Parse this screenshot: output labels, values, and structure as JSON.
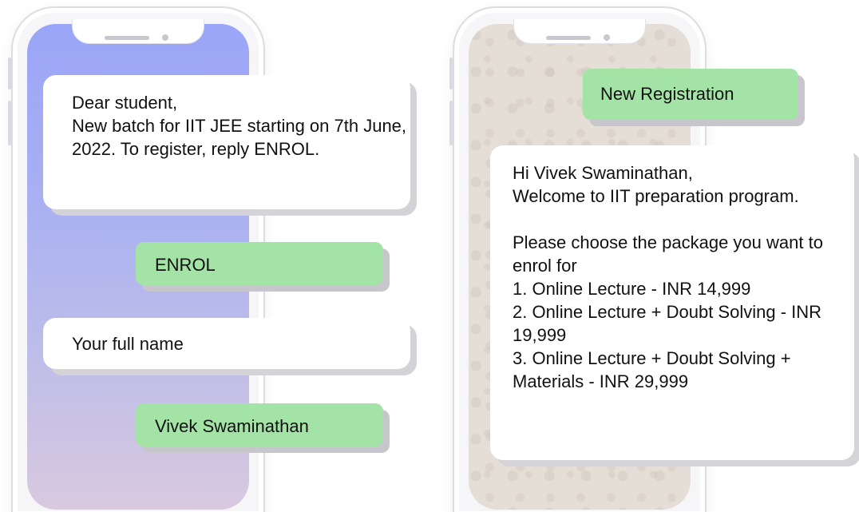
{
  "left_phone": {
    "messages": {
      "broadcast": "Dear student,\nNew batch for IIT JEE starting on 7th June, 2022. To register, reply ENROL.",
      "reply_enrol": "ENROL",
      "prompt_name": "Your full name",
      "reply_name": "Vivek Swaminathan"
    }
  },
  "right_phone": {
    "messages": {
      "reply_registration": "New Registration",
      "welcome": "Hi Vivek Swaminathan,\nWelcome to IIT preparation program.\n\nPlease choose the package you want to enrol for\n1. Online Lecture - INR 14,999\n2. Online Lecture + Doubt Solving - INR 19,999\n3. Online Lecture + Doubt Solving + Materials - INR 29,999"
    }
  },
  "colors": {
    "incoming_bubble": "#ffffff",
    "outgoing_bubble": "#a4e3a6",
    "left_screen": "#a8b0f2",
    "right_screen": "#e5ded6"
  }
}
